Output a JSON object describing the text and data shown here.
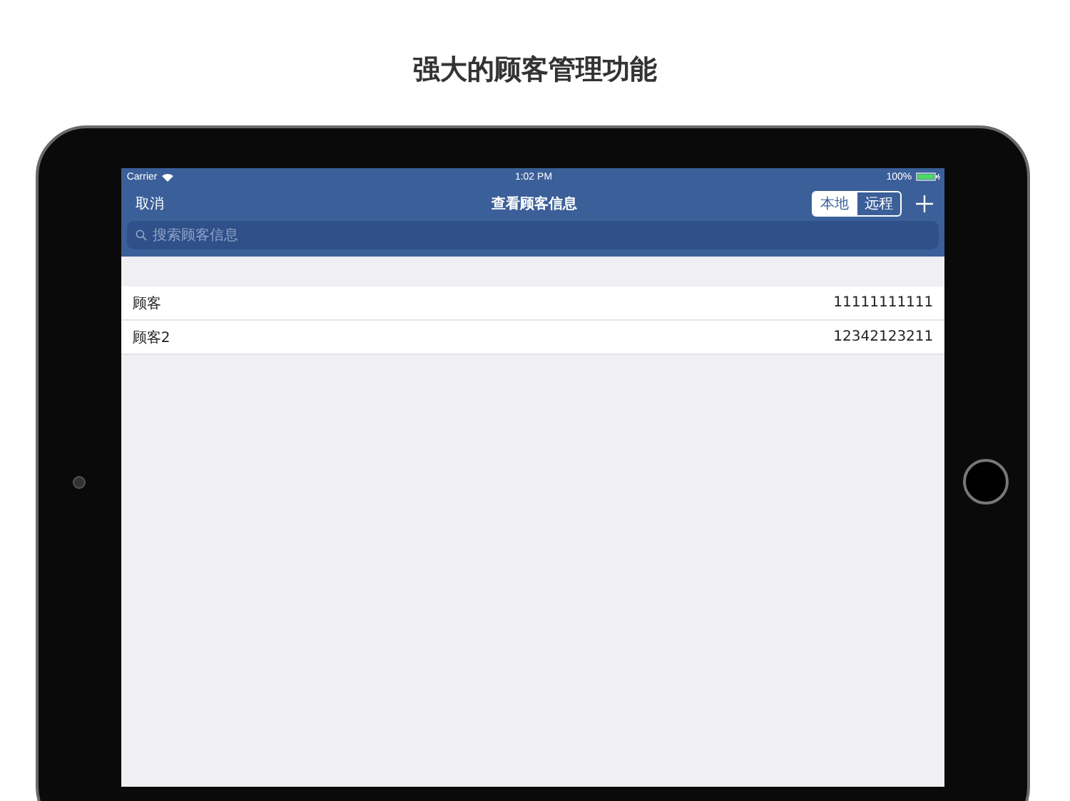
{
  "headline": "强大的顾客管理功能",
  "status_bar": {
    "carrier": "Carrier",
    "time": "1:02 PM",
    "battery": "100%"
  },
  "nav": {
    "left_button": "取消",
    "title": "查看顾客信息",
    "segments": [
      {
        "label": "本地",
        "selected": true
      },
      {
        "label": "远程",
        "selected": false
      }
    ]
  },
  "search": {
    "placeholder": "搜索顾客信息"
  },
  "customers": [
    {
      "name": "顾客",
      "phone": "11111111111"
    },
    {
      "name": "顾客2",
      "phone": "12342123211"
    }
  ]
}
